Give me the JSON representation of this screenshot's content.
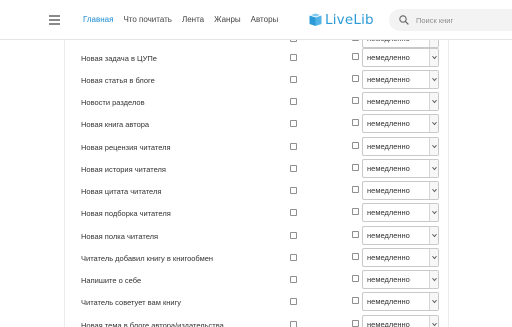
{
  "header": {
    "nav": [
      "Главная",
      "Что почитать",
      "Лента",
      "Жанры",
      "Авторы"
    ],
    "logo_text": "LiveLib",
    "search_placeholder": "Поиск книг"
  },
  "colors": {
    "accent": "#1a8bd1",
    "logo": "#2b9ad6"
  },
  "rows": [
    {
      "label": "",
      "select": "немедленно"
    },
    {
      "label": "Новая задача в ЦУПе",
      "select": "немедленно"
    },
    {
      "label": "Новая статья в блоге",
      "select": "немедленно"
    },
    {
      "label": "Новости разделов",
      "select": "немедленно"
    },
    {
      "label": "Новая книга автора",
      "select": "немедленно"
    },
    {
      "label": "Новая рецензия читателя",
      "select": "немедленно"
    },
    {
      "label": "Новая история читателя",
      "select": "немедленно"
    },
    {
      "label": "Новая цитата читателя",
      "select": "немедленно"
    },
    {
      "label": "Новая подборка читателя",
      "select": "немедленно"
    },
    {
      "label": "Новая полка читателя",
      "select": "немедленно"
    },
    {
      "label": "Читатель добавил книгу в книгообмен",
      "select": "немедленно"
    },
    {
      "label": "Напишите о себе",
      "select": "немедленно"
    },
    {
      "label": "Читатель советует вам книгу",
      "select": "немедленно"
    },
    {
      "label": "Новая тема в блоге автора/издательства",
      "select": "немедленно"
    }
  ]
}
